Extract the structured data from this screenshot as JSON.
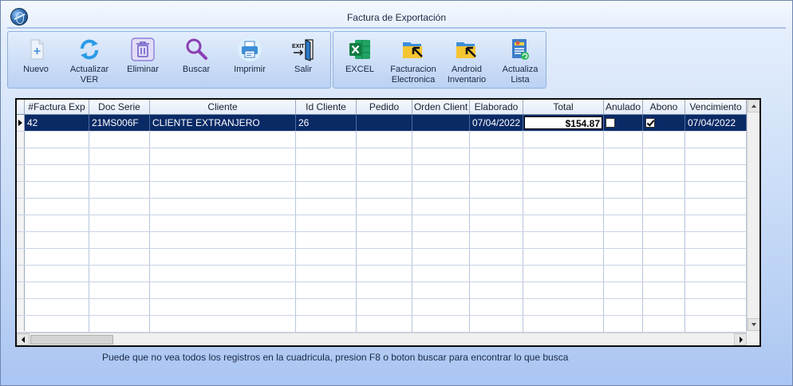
{
  "window": {
    "title": "Factura de Exportación"
  },
  "toolbar": {
    "group1": [
      {
        "id": "nuevo",
        "label": "Nuevo",
        "icon": "new-document-icon"
      },
      {
        "id": "actualizar",
        "label": "Actualizar\nVER",
        "icon": "refresh-icon"
      },
      {
        "id": "eliminar",
        "label": "Eliminar",
        "icon": "trash-icon"
      },
      {
        "id": "buscar",
        "label": "Buscar",
        "icon": "search-icon"
      },
      {
        "id": "imprimir",
        "label": "Imprimir",
        "icon": "printer-icon"
      },
      {
        "id": "salir",
        "label": "Salir",
        "icon": "exit-icon"
      }
    ],
    "group2": [
      {
        "id": "excel",
        "label": "EXCEL",
        "icon": "excel-icon"
      },
      {
        "id": "facturacion",
        "label": "Facturacion\nElectronica",
        "icon": "folder-arrow-icon"
      },
      {
        "id": "android",
        "label": "Android\nInventario",
        "icon": "folder-arrow-icon"
      },
      {
        "id": "actualiza_lista",
        "label": "Actualiza\nLista",
        "icon": "list-refresh-icon"
      }
    ]
  },
  "grid": {
    "columns": [
      "#Factura Exp",
      "Doc Serie",
      "Cliente",
      "Id Cliente",
      "Pedido",
      "Orden Client",
      "Elaborado",
      "Total",
      "Anulado",
      "Abono",
      "Vencimiento"
    ],
    "rows": [
      {
        "factura": "42",
        "doc_serie": "21MS006F",
        "cliente": "CLIENTE EXTRANJERO",
        "id_cliente": "26",
        "pedido": "",
        "orden_client": "",
        "elaborado": "07/04/2022",
        "total": "$154.87",
        "anulado": false,
        "abono": true,
        "vencimiento": "07/04/2022"
      }
    ],
    "empty_rows": 12
  },
  "hint": "Puede que no vea todos los registros en la cuadricula, presion F8 o boton buscar para encontrar lo que busca",
  "colors": {
    "selected_row": "#0a2a66",
    "window_bg_bottom": "#a9c5f2",
    "toolbar_border": "#8fb0de"
  }
}
